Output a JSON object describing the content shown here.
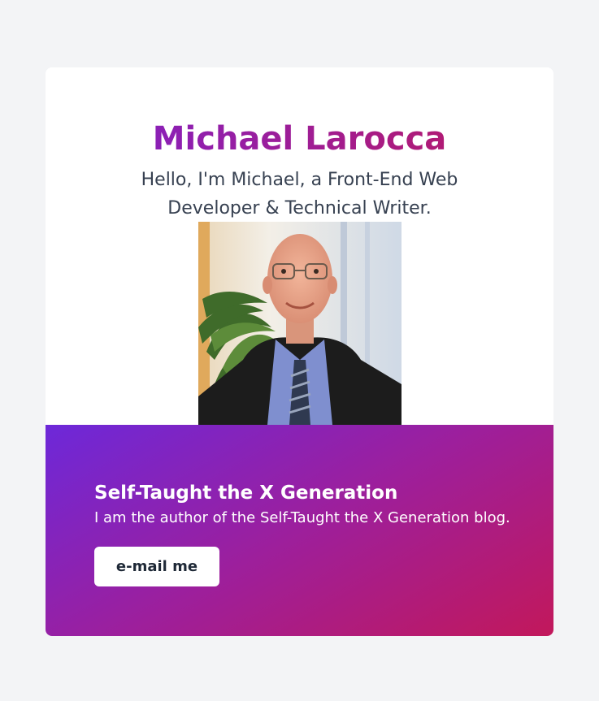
{
  "profile": {
    "name": "Michael Larocca",
    "tagline": "Hello, I'm Michael, a Front-End Web Developer & Technical Writer.",
    "photo_alt": "Michael Larocca"
  },
  "blog": {
    "title": "Self-Taught the X Generation",
    "description": "I am the author of the Self-Taught the X Generation blog.",
    "button_label": "e-mail me"
  },
  "colors": {
    "page_background": "#f3f4f6",
    "name_gradient_start": "#7e22ce",
    "name_gradient_end": "#be185d",
    "panel_gradient_start": "#6d28d9",
    "panel_gradient_end": "#c2185b",
    "button_background": "#ffffff",
    "button_text": "#1f2937"
  }
}
